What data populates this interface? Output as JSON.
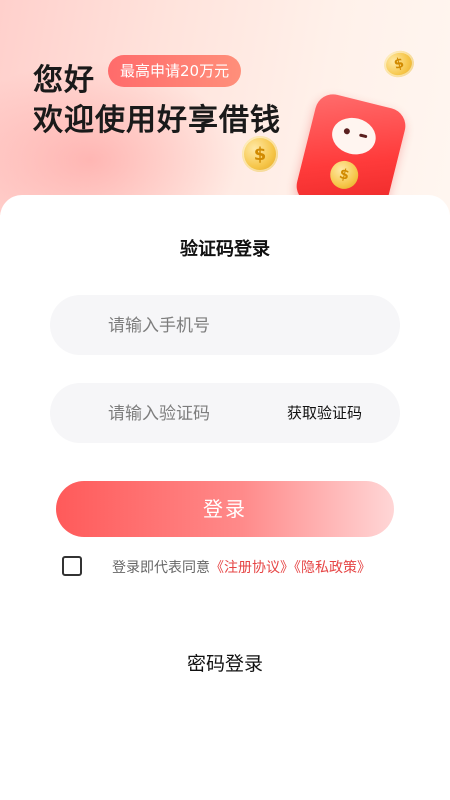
{
  "hero": {
    "greeting": "您好",
    "badge": "最高申请20万元",
    "title": "欢迎使用好享借钱",
    "coin_symbol": "$"
  },
  "form": {
    "title": "验证码登录",
    "phone_placeholder": "请输入手机号",
    "code_placeholder": "请输入验证码",
    "get_code_label": "获取验证码",
    "login_label": "登录",
    "agreement_prefix": "登录即代表同意",
    "agreement_link": "《注册协议》",
    "privacy_link": "《隐私政策》",
    "agreement_checked": false
  },
  "alt_login": {
    "password_login_label": "密码登录"
  },
  "colors": {
    "brand_red": "#ff5a5a",
    "link_red": "#e64545",
    "field_bg": "#f6f6f8"
  },
  "icons": {
    "coin": "coin-icon",
    "mascot": "red-envelope-mascot-icon",
    "checkbox": "checkbox-icon"
  }
}
